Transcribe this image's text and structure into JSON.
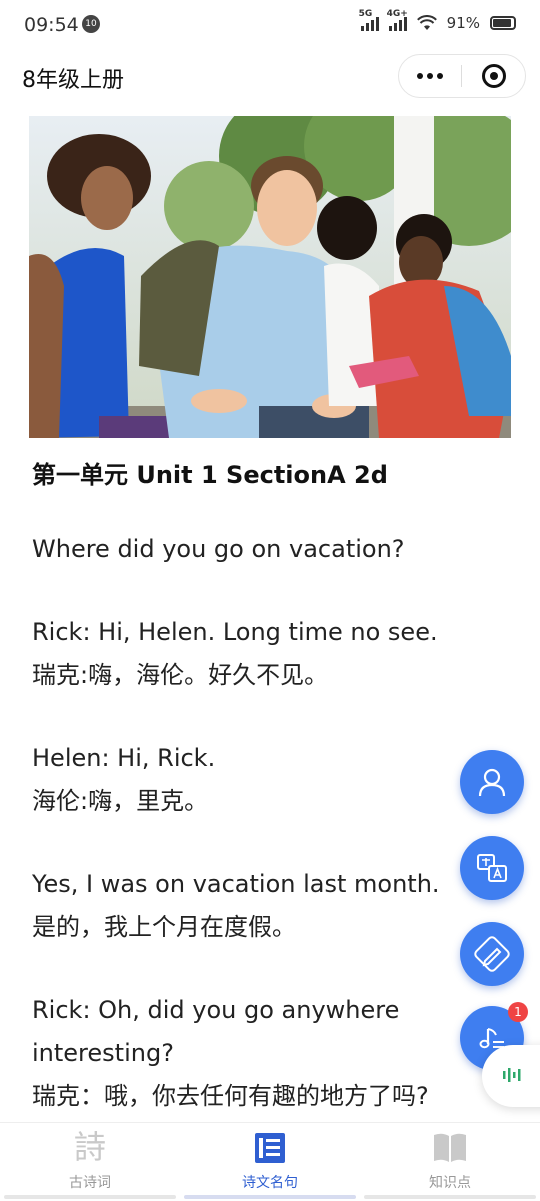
{
  "status": {
    "time": "09:54",
    "notif_badge": "10",
    "net1": "5G",
    "net2": "4G+",
    "battery": "91%"
  },
  "header": {
    "title": "8年级上册",
    "more_icon": "more-dots-icon",
    "close_icon": "target-close-icon"
  },
  "article": {
    "heading": "第一单元 Unit 1  SectionA 2d",
    "subtitle": "Where did you go on vacation?",
    "lines": [
      {
        "en": "Rick: Hi, Helen. Long time no see.",
        "zh": "瑞克:嗨，海伦。好久不见。"
      },
      {
        "en": "Helen: Hi, Rick.",
        "zh": "海伦:嗨，里克。"
      },
      {
        "en": "Yes, I was on vacation last month.",
        "zh": "是的，我上个月在度假。"
      },
      {
        "en": "Rick: Oh, did you go anywhere interesting?",
        "zh": "瑞克：哦，你去任何有趣的地方了吗?"
      }
    ]
  },
  "fabs": [
    {
      "icon": "user-icon"
    },
    {
      "icon": "translate-icon"
    },
    {
      "icon": "pencil-edit-icon"
    },
    {
      "icon": "music-note-icon",
      "badge": "1"
    }
  ],
  "bottom_nav": [
    {
      "label": "古诗词",
      "icon": "poem-icon",
      "glyph": "詩",
      "active": false
    },
    {
      "label": "诗文名句",
      "icon": "document-list-icon",
      "active": true
    },
    {
      "label": "知识点",
      "icon": "book-icon",
      "active": false
    }
  ],
  "colors": {
    "accent": "#3f7ef0",
    "nav_active": "#2f5fd1",
    "badge": "#ef4444"
  }
}
